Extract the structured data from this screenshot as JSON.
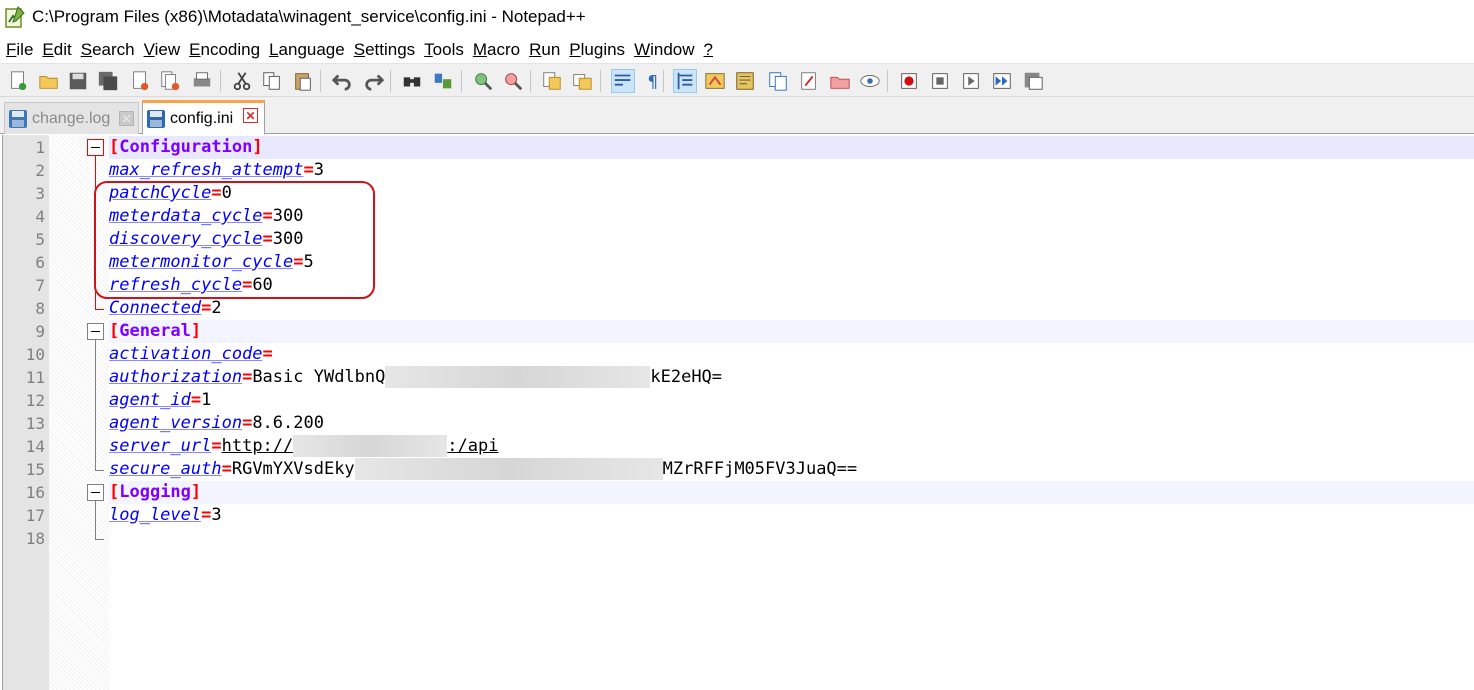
{
  "window": {
    "title": "C:\\Program Files (x86)\\Motadata\\winagent_service\\config.ini - Notepad++"
  },
  "menu": [
    {
      "label": "File",
      "u": "F",
      "rest": "ile"
    },
    {
      "label": "Edit",
      "u": "E",
      "rest": "dit"
    },
    {
      "label": "Search",
      "u": "S",
      "rest": "earch"
    },
    {
      "label": "View",
      "u": "V",
      "rest": "iew"
    },
    {
      "label": "Encoding",
      "u": "E",
      "rest": "ncoding"
    },
    {
      "label": "Language",
      "u": "L",
      "rest": "anguage"
    },
    {
      "label": "Settings",
      "u": "S",
      "rest": "ettings"
    },
    {
      "label": "Tools",
      "u": "T",
      "rest": "ools"
    },
    {
      "label": "Macro",
      "u": "M",
      "rest": "acro"
    },
    {
      "label": "Run",
      "u": "R",
      "rest": "un"
    },
    {
      "label": "Plugins",
      "u": "P",
      "rest": "lugins"
    },
    {
      "label": "Window",
      "u": "W",
      "rest": "indow"
    },
    {
      "label": "?",
      "u": "?",
      "rest": ""
    }
  ],
  "toolbar_icons": [
    "new-file-icon",
    "open-file-icon",
    "save-icon",
    "save-all-icon",
    "close-icon",
    "close-all-icon",
    "print-icon",
    "cut-icon",
    "copy-icon",
    "paste-icon",
    "undo-icon",
    "redo-icon",
    "find-icon",
    "replace-icon",
    "zoom-in-icon",
    "zoom-out-icon",
    "sync-vertical-icon",
    "sync-horizontal-icon",
    "word-wrap-icon",
    "show-all-chars-icon",
    "indent-guide-icon",
    "user-language-icon",
    "doc-map-icon",
    "doc-list-icon",
    "function-list-icon",
    "folder-workspace-icon",
    "monitoring-icon",
    "record-macro-icon",
    "stop-record-icon",
    "play-macro-icon",
    "run-multiple-macro-icon",
    "save-macro-icon"
  ],
  "tabs": [
    {
      "label": "change.log",
      "active": false
    },
    {
      "label": "config.ini",
      "active": true
    }
  ],
  "editor": {
    "line_numbers": [
      "1",
      "2",
      "3",
      "4",
      "5",
      "6",
      "7",
      "8",
      "9",
      "10",
      "11",
      "12",
      "13",
      "14",
      "15",
      "16",
      "17",
      "18"
    ],
    "lines": [
      {
        "type": "section",
        "name": "Configuration"
      },
      {
        "type": "kv",
        "key": "max_refresh_attempt",
        "value": "3"
      },
      {
        "type": "kv",
        "key": "patchCycle",
        "value": "0"
      },
      {
        "type": "kv",
        "key": "meterdata_cycle",
        "value": "300"
      },
      {
        "type": "kv",
        "key": "discovery_cycle",
        "value": "300"
      },
      {
        "type": "kv",
        "key": "metermonitor_cycle",
        "value": "5"
      },
      {
        "type": "kv",
        "key": "refresh_cycle",
        "value": "60"
      },
      {
        "type": "kv",
        "key": "Connected",
        "value": "2"
      },
      {
        "type": "section",
        "name": "General"
      },
      {
        "type": "kv",
        "key": "activation_code",
        "value": ""
      },
      {
        "type": "kv",
        "key": "authorization",
        "value_prefix": "Basic YWdlbnQ",
        "value_suffix": "kE2eHQ="
      },
      {
        "type": "kv",
        "key": "agent_id",
        "value": "1"
      },
      {
        "type": "kv",
        "key": "agent_version",
        "value": "8.6.200"
      },
      {
        "type": "kv",
        "key": "server_url",
        "value_prefix": "http://",
        "value_suffix": ":/api"
      },
      {
        "type": "kv",
        "key": "secure_auth",
        "value_prefix": "RGVmYXVsdEky",
        "value_suffix": "MZrRFFjM05FV3JuaQ=="
      },
      {
        "type": "section",
        "name": "Logging"
      },
      {
        "type": "kv",
        "key": "log_level",
        "value": "3"
      },
      {
        "type": "empty"
      }
    ]
  },
  "colors": {
    "section": "#8000ff",
    "key": "#0000ff",
    "operator": "#ff0000",
    "current_line": "#e8e8ff",
    "annotation": "#d0121b",
    "tab_accent": "#f9a44a"
  }
}
